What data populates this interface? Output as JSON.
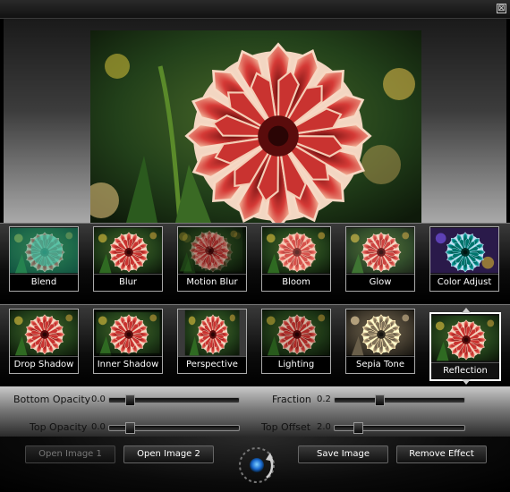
{
  "window": {
    "close_glyph": "⊠"
  },
  "effects_row1": [
    {
      "label": "Blend"
    },
    {
      "label": "Blur"
    },
    {
      "label": "Motion Blur"
    },
    {
      "label": "Bloom"
    },
    {
      "label": "Glow"
    },
    {
      "label": "Color Adjust"
    }
  ],
  "effects_row2": [
    {
      "label": "Drop Shadow"
    },
    {
      "label": "Inner Shadow"
    },
    {
      "label": "Perspective"
    },
    {
      "label": "Lighting"
    },
    {
      "label": "Sepia Tone"
    },
    {
      "label": "Reflection",
      "selected": true
    }
  ],
  "sliders": {
    "bottom_opacity": {
      "label": "Bottom Opacity",
      "value": "0.0",
      "level": 0.0
    },
    "top_opacity": {
      "label": "Top Opacity",
      "value": "0.0",
      "level": 0.0
    },
    "fraction": {
      "label": "Fraction",
      "value": "0.2",
      "level": 0.2
    },
    "top_offset": {
      "label": "Top Offset",
      "value": "2.0",
      "level": 0.02
    }
  },
  "buttons": {
    "open_image_1": "Open Image 1",
    "open_image_2": "Open Image 2",
    "save_image": "Save Image",
    "remove_effect": "Remove Effect"
  },
  "colors": {
    "petal": "#d63a3a",
    "petal_edge": "#f6d0b6",
    "foliage": "#1f4a16",
    "accent_blue": "#3aa0ff"
  }
}
